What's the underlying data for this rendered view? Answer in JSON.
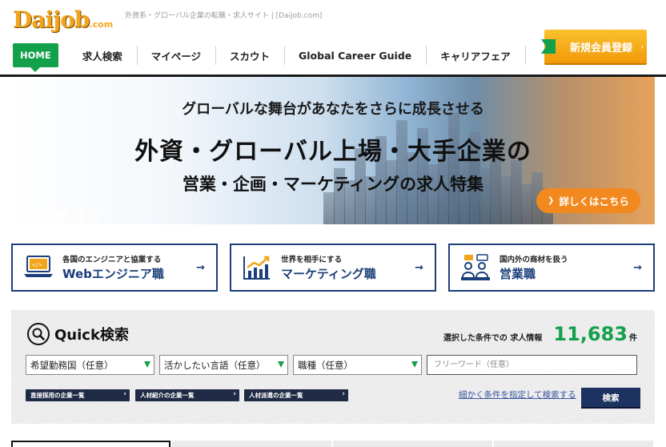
{
  "header": {
    "logo": "Daijob",
    "logo_suffix": ".com",
    "tagline": "外資系・グローバル企業の転職・求人サイト | [Daijob.com]",
    "register_label": "新規会員登録"
  },
  "nav": {
    "items": [
      "HOME",
      "求人検索",
      "マイページ",
      "スカウト",
      "Global Career Guide",
      "キャリアフェア"
    ]
  },
  "banner": {
    "subtitle": "グローバルな舞台があなたをさらに成長させる",
    "title": "外資・グローバル上場・大手企業の",
    "subtitle2": "営業・企画・マーケティングの求人特集",
    "cta": "詳しくはこちら",
    "slide_count": 4,
    "active_slide": 1
  },
  "cards": [
    {
      "small": "各国のエンジニアと協業する",
      "big": "Webエンジニア職",
      "icon": "laptop-code-icon"
    },
    {
      "small": "世界を相手にする",
      "big": "マーケティング職",
      "icon": "chart-growth-icon"
    },
    {
      "small": "国内外の商材を扱う",
      "big": "営業職",
      "icon": "team-meeting-icon"
    }
  ],
  "quick_search": {
    "title": "Quick検索",
    "count_label": "選択した条件での 求人情報",
    "count": "11,683",
    "count_unit": "件",
    "selects": [
      "希望勤務国（任意）",
      "活かしたい言語（任意）",
      "職種（任意）"
    ],
    "freeword_placeholder": "フリーワード（任意）",
    "links": [
      "直接採用の企業一覧",
      "人材紹介の企業一覧",
      "人材派遣の企業一覧"
    ],
    "detail_link": "細かく条件を指定して検索する",
    "search_button": "検索"
  },
  "colors": {
    "brand_green": "#13a04a",
    "navy": "#1c3f7a",
    "orange": "#f2891e",
    "logo_gold": "#f2a41a"
  }
}
